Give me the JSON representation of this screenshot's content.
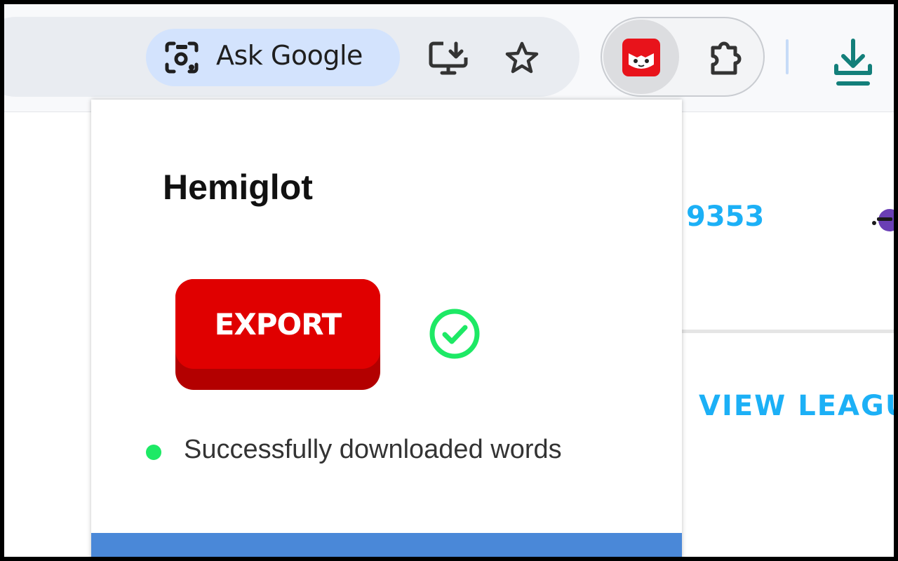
{
  "toolbar": {
    "ask_google_label": "Ask Google",
    "icons": [
      "lens-camera-icon",
      "install-app-icon",
      "bookmark-star-icon",
      "hemiglot-extension-icon",
      "extensions-puzzle-icon",
      "download-icon"
    ]
  },
  "background_page": {
    "number": "9353",
    "link_text": "VIEW LEAGU"
  },
  "popup": {
    "title": "Hemiglot",
    "export_label": "EXPORT",
    "status_text": "Successfully downloaded words"
  },
  "colors": {
    "export_red": "#e00000",
    "success_green": "#1de965",
    "link_blue": "#1cb0f6",
    "footer_blue": "#4a88d8"
  }
}
